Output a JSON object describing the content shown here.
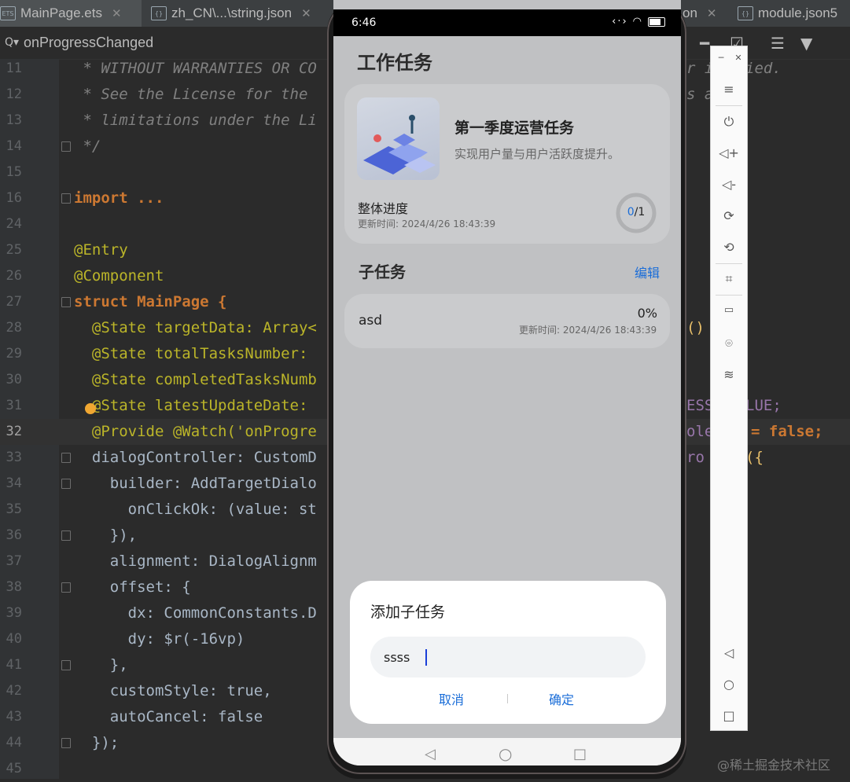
{
  "tabs": [
    {
      "label": "MainPage.ets",
      "icon": "ets-file-icon"
    },
    {
      "label": "zh_CN\\...\\string.json",
      "icon": "json-file-icon"
    },
    {
      "label": "on",
      "icon": "json-file-icon"
    },
    {
      "label": "module.json5",
      "icon": "json-file-icon"
    }
  ],
  "breadcrumb": {
    "label": "onProgressChanged"
  },
  "lines": [
    {
      "n": "11",
      "text": " * WITHOUT WARRANTIES OR CO"
    },
    {
      "n": "12",
      "text": " * See the License for the "
    },
    {
      "n": "13",
      "text": " * limitations under the Li"
    },
    {
      "n": "14",
      "text": " */"
    },
    {
      "n": "15",
      "text": ""
    },
    {
      "n": "16",
      "text": "import ..."
    },
    {
      "n": "24",
      "text": ""
    },
    {
      "n": "25",
      "text": "@Entry"
    },
    {
      "n": "26",
      "text": "@Component"
    },
    {
      "n": "27",
      "text": "struct MainPage {"
    },
    {
      "n": "28",
      "text": "  @State targetData: Array<"
    },
    {
      "n": "29",
      "text": "  @State totalTasksNumber: "
    },
    {
      "n": "30",
      "text": "  @State completedTasksNumb"
    },
    {
      "n": "31",
      "text": "  @State latestUpdateDate: "
    },
    {
      "n": "32",
      "text": "  @Provide @Watch('onProgre"
    },
    {
      "n": "33",
      "text": "  dialogController: CustomD"
    },
    {
      "n": "34",
      "text": "    builder: AddTargetDialo"
    },
    {
      "n": "35",
      "text": "      onClickOk: (value: st"
    },
    {
      "n": "36",
      "text": "    }),"
    },
    {
      "n": "37",
      "text": "    alignment: DialogAlignm"
    },
    {
      "n": "38",
      "text": "    offset: {"
    },
    {
      "n": "39",
      "text": "      dx: CommonConstants.D"
    },
    {
      "n": "40",
      "text": "      dy: $r(-16vp)"
    },
    {
      "n": "41",
      "text": "    },"
    },
    {
      "n": "42",
      "text": "    customStyle: true,"
    },
    {
      "n": "43",
      "text": "    autoCancel: false"
    },
    {
      "n": "44",
      "text": "  });"
    },
    {
      "n": "45",
      "text": ""
    }
  ],
  "right_fragments": {
    "l11": "r is",
    "l11b": "ied.",
    "l12": "s a",
    "l28": "()",
    "l31": "ESS",
    "l31b": "LUE;",
    "l32": "ole",
    "l32b": "= false;",
    "l33": "ro",
    "l33b": "({"
  },
  "watermark": "@稀土掘金技术社区",
  "phone": {
    "status_time": "6:46",
    "page_title": "工作任务",
    "task": {
      "title": "第一季度运营任务",
      "desc": "实现用户量与用户活跃度提升。",
      "progress_label": "整体进度",
      "update_time": "更新时间: 2024/4/26 18:43:39",
      "done": "0",
      "total": "/1"
    },
    "subtasks_title": "子任务",
    "edit_label": "编辑",
    "subtasks": [
      {
        "name": "asd",
        "percent": "0%",
        "update_time": "更新时间: 2024/4/26 18:43:39"
      }
    ],
    "dialog": {
      "title": "添加子任务",
      "input_value": "ssss",
      "cancel": "取消",
      "confirm": "确定"
    }
  },
  "colors": {
    "accent": "#1a6dd8",
    "ide_bg": "#2b2b2b",
    "phone_bg": "#c0c1c3"
  }
}
